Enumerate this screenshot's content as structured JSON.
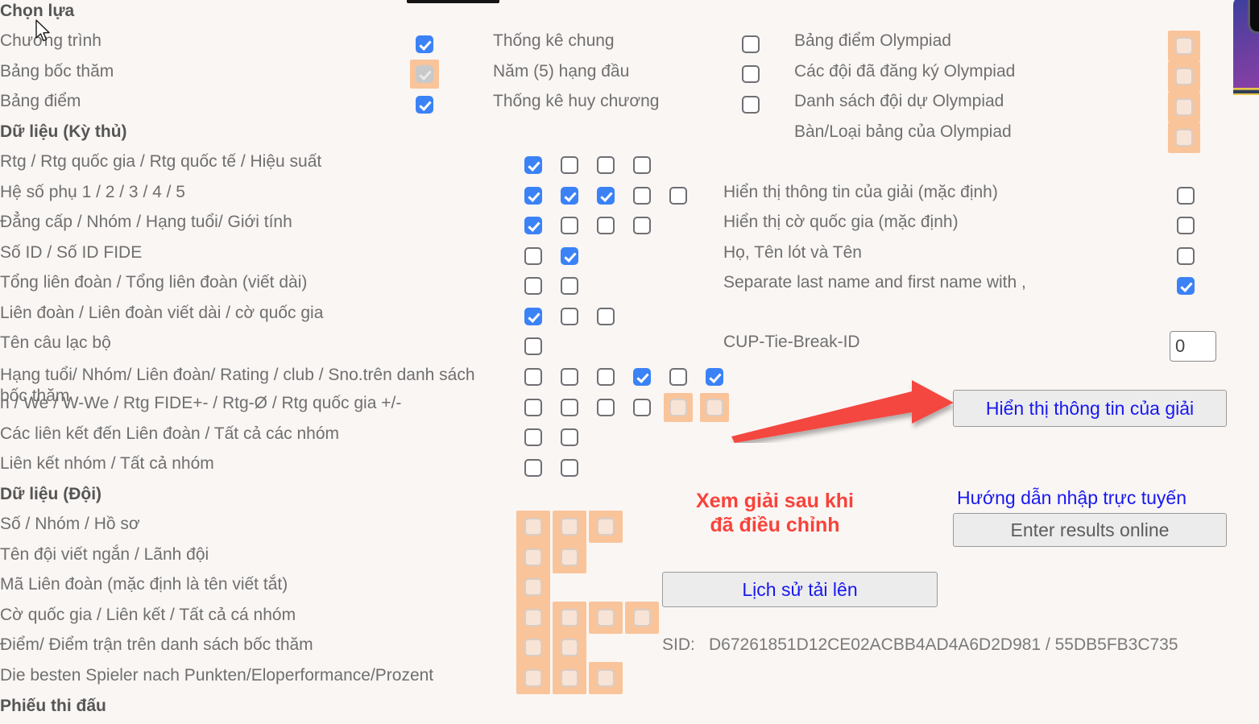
{
  "window": {
    "background_color": "#faf6f4",
    "accent_blue": "#3b82f6",
    "highlight_orange": "#f9c49a",
    "link_blue": "#1818f0",
    "alert_red": "#f9423a"
  },
  "sections": {
    "selection_heading": "Chọn lựa",
    "player_data_heading": "Dữ liệu (Kỳ thủ)",
    "team_data_heading": "Dữ liệu (Đội)",
    "scoresheet_heading": "Phiếu thi đấu"
  },
  "left_column": {
    "selection_items": [
      {
        "label": "Chương trình"
      },
      {
        "label": "Bảng bốc thăm"
      },
      {
        "label": "Bảng điểm"
      }
    ],
    "player_items": [
      {
        "label": "Rtg / Rtg quốc gia / Rtg quốc tế / Hiệu suất"
      },
      {
        "label": "Hệ số phụ 1 / 2 / 3 / 4 / 5"
      },
      {
        "label": "Đẳng cấp / Nhóm / Hạng tuổi/ Giới tính"
      },
      {
        "label": "Số ID / Số ID FIDE"
      },
      {
        "label": "Tổng liên đoàn / Tổng liên đoàn (viết dài)"
      },
      {
        "label": "Liên đoàn / Liên đoàn viết dài / cờ quốc gia"
      },
      {
        "label": "Tên câu lạc bộ"
      },
      {
        "label": "Hạng tuổi/ Nhóm/ Liên đoàn/ Rating / club / Sno.trên danh sách bốc thăm"
      },
      {
        "label": "n / We / W-We / Rtg FIDE+- / Rtg-Ø / Rtg quốc gia +/-"
      },
      {
        "label": "Các liên kết đến Liên đoàn / Tất cả các nhóm"
      },
      {
        "label": "Liên kết nhóm / Tất cả nhóm"
      }
    ],
    "team_items": [
      {
        "label": "Số / Nhóm / Hồ sơ"
      },
      {
        "label": "Tên đội viết ngắn / Lãnh đội"
      },
      {
        "label": "Mã Liên đoàn (mặc định là tên viết tắt)"
      },
      {
        "label": "Cờ quốc gia / Liên kết / Tất cả cá nhóm"
      },
      {
        "label": "Điểm/ Điểm trận trên danh sách bốc thăm"
      },
      {
        "label": "Die besten Spieler nach Punkten/Eloperformance/Prozent"
      }
    ]
  },
  "selection_checkboxes": [
    {
      "name": "chuong-trinh",
      "state": "checked"
    },
    {
      "name": "bang-boc-tham",
      "state": "disabled-checked",
      "highlighted": true
    },
    {
      "name": "bang-diem",
      "state": "checked"
    }
  ],
  "stats_options": [
    {
      "label": "Thống kê chung",
      "state": "unchecked"
    },
    {
      "label": "Năm (5) hạng đầu",
      "state": "unchecked"
    },
    {
      "label": "Thống kê huy chương",
      "state": "unchecked"
    }
  ],
  "olympiad_options": [
    {
      "label": "Bảng điểm Olympiad",
      "state": "ghost",
      "highlighted": true
    },
    {
      "label": "Các đội đã đăng ký Olympiad",
      "state": "ghost",
      "highlighted": true
    },
    {
      "label": "Danh sách đội dự Olympiad",
      "state": "ghost",
      "highlighted": true
    },
    {
      "label": "Bàn/Loại bảng của Olympiad",
      "state": "ghost",
      "highlighted": true
    }
  ],
  "display_options": [
    {
      "label": "Hiển thị thông tin của giải (mặc định)",
      "state": "unchecked"
    },
    {
      "label": "Hiển thị cờ quốc gia (mặc định)",
      "state": "unchecked"
    },
    {
      "label": "Họ, Tên lót và Tên",
      "state": "unchecked"
    },
    {
      "label": "Separate last name and first name with ,",
      "state": "checked"
    }
  ],
  "cup_tie_break": {
    "label": "CUP-Tie-Break-ID",
    "value": "0"
  },
  "checkbox_grid_player": [
    {
      "row": 0,
      "states": [
        "checked",
        "unchecked",
        "unchecked",
        "unchecked"
      ]
    },
    {
      "row": 1,
      "states": [
        "checked",
        "checked",
        "checked",
        "unchecked",
        "unchecked"
      ]
    },
    {
      "row": 2,
      "states": [
        "checked",
        "unchecked",
        "unchecked",
        "unchecked"
      ]
    },
    {
      "row": 3,
      "states": [
        "unchecked",
        "checked"
      ]
    },
    {
      "row": 4,
      "states": [
        "unchecked",
        "unchecked"
      ]
    },
    {
      "row": 5,
      "states": [
        "checked",
        "unchecked",
        "unchecked"
      ]
    },
    {
      "row": 6,
      "states": [
        "unchecked"
      ]
    },
    {
      "row": 7,
      "states": [
        "unchecked",
        "unchecked",
        "unchecked",
        "checked",
        "unchecked",
        "checked"
      ]
    },
    {
      "row": 8,
      "states": [
        "unchecked",
        "unchecked",
        "unchecked",
        "unchecked",
        "ghost",
        "ghost"
      ]
    },
    {
      "row": 9,
      "states": [
        "unchecked",
        "unchecked"
      ]
    },
    {
      "row": 10,
      "states": [
        "unchecked",
        "unchecked"
      ]
    }
  ],
  "checkbox_grid_team": [
    {
      "row": 0,
      "states": [
        "ghost",
        "ghost",
        "ghost"
      ]
    },
    {
      "row": 1,
      "states": [
        "ghost",
        "ghost"
      ]
    },
    {
      "row": 2,
      "states": [
        "ghost"
      ]
    },
    {
      "row": 3,
      "states": [
        "ghost",
        "ghost",
        "ghost",
        "ghost"
      ]
    },
    {
      "row": 4,
      "states": [
        "ghost",
        "ghost"
      ]
    },
    {
      "row": 5,
      "states": [
        "ghost",
        "ghost",
        "ghost"
      ]
    }
  ],
  "annotation": {
    "red_note": "Xem giải sau khi\nđã điều chỉnh",
    "arrow": "red-arrow pointing to the tournament-info button"
  },
  "buttons": {
    "show_tournament_info": "Hiển thị thông tin của giải",
    "online_entry_guide_link": "Hướng dẫn nhập trực tuyến",
    "enter_results_online": "Enter results online",
    "upload_history": "Lịch sử tải lên"
  },
  "footer": {
    "sid_label": "SID:",
    "sid_value": "D67261851D12CE02ACBB4AD4A6D2D981 / 55DB5FB3C735"
  }
}
